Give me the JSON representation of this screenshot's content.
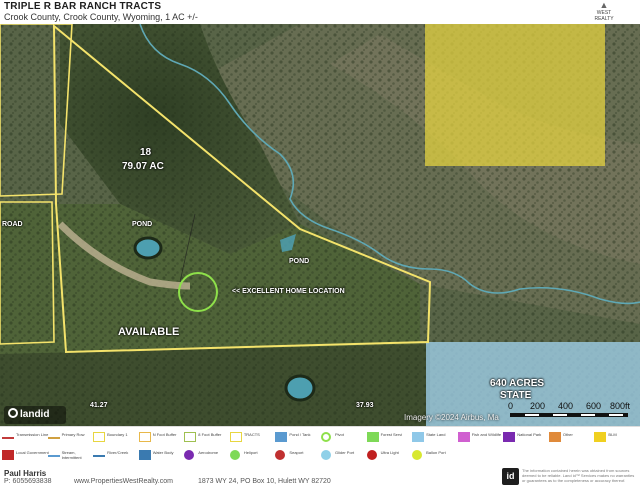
{
  "header": {
    "title": "TRIPLE R BAR RANCH TRACTS",
    "subtitle": "Crook County, Crook County, Wyoming, 1 AC +/-",
    "brand_name": "WEST REALTY"
  },
  "map": {
    "labels": {
      "tract_number": "18",
      "tract_acres": "79.07  AC",
      "pond_west": "POND",
      "pond_center": "POND",
      "home_location": "<< EXCELLENT HOME LOCATION",
      "available": "AVAILABLE",
      "road_fragment": "ROAD",
      "state_acres": "640 ACRES",
      "state_label": "STATE",
      "bottom_marker_left": "41.27",
      "bottom_marker_right": "37.93"
    },
    "attribution": "Imagery ©2024 Airbus, Ma",
    "scale": {
      "ticks": [
        "0",
        "200",
        "400",
        "600",
        "800ft"
      ]
    },
    "logo_text": "landid box",
    "colors": {
      "boundary": "#f4e36b",
      "blm_overlay": "#e8d640",
      "state_overlay": "#9fd0ea",
      "river": "#5fa8b5",
      "pond": "#4d9fb0",
      "home_marker": "#8ee04a"
    }
  },
  "legend": {
    "items": [
      {
        "label": "Transmission Line",
        "color": "#c23b3b"
      },
      {
        "label": "Primary Row",
        "color": "#d0a040"
      },
      {
        "label": "Boundary 1",
        "color": "#e8d640"
      },
      {
        "label": "N Foot Buffer",
        "color": "#e8b84a"
      },
      {
        "label": "8 Foot Buffer",
        "color": "#9fc050"
      },
      {
        "label": "TRACTS",
        "color": "#e8d640"
      },
      {
        "label": "Pond / Tank",
        "color": "#5a9ad0"
      },
      {
        "label": "Pivot",
        "color": "#8ee04a"
      },
      {
        "label": "Forest Servi",
        "color": "#7ed957"
      },
      {
        "label": "State Land",
        "color": "#8fc8e8"
      },
      {
        "label": "Fish and Wildlife",
        "color": "#d060d0"
      },
      {
        "label": "National Park",
        "color": "#7a2ab0"
      },
      {
        "label": "Other",
        "color": "#e08a3a"
      },
      {
        "label": "BLM",
        "color": "#f0d020"
      },
      {
        "label": "Local Government",
        "color": "#c02828"
      },
      {
        "label": "Stream, Intermittent",
        "color": "#5a9ad0"
      },
      {
        "label": "River/Creek",
        "color": "#3a7ab0"
      },
      {
        "label": "Water Body",
        "color": "#3a7ab0"
      },
      {
        "label": "Aerodrome",
        "color": "#7a2ab0"
      },
      {
        "label": "Heliport",
        "color": "#7ed957"
      },
      {
        "label": "Seaport",
        "color": "#c03030"
      },
      {
        "label": "Glider Port",
        "color": "#8fd0e8"
      },
      {
        "label": "Ultra Light",
        "color": "#c02020"
      },
      {
        "label": "Ballon Port",
        "color": "#d8e830"
      }
    ]
  },
  "footer": {
    "agent_name": "Paul Harris",
    "phone": "P: 6055693838",
    "website": "www.PropertiesWestRealty.com",
    "address": "1873 WY 24, PO Box 10, Hulett WY 82720",
    "badge": "id",
    "disclaimer": "The information contained herein was obtained from sources deemed to be reliable. Land id™ Services makes no warranties or guarantees as to the completeness or accuracy thereof."
  }
}
